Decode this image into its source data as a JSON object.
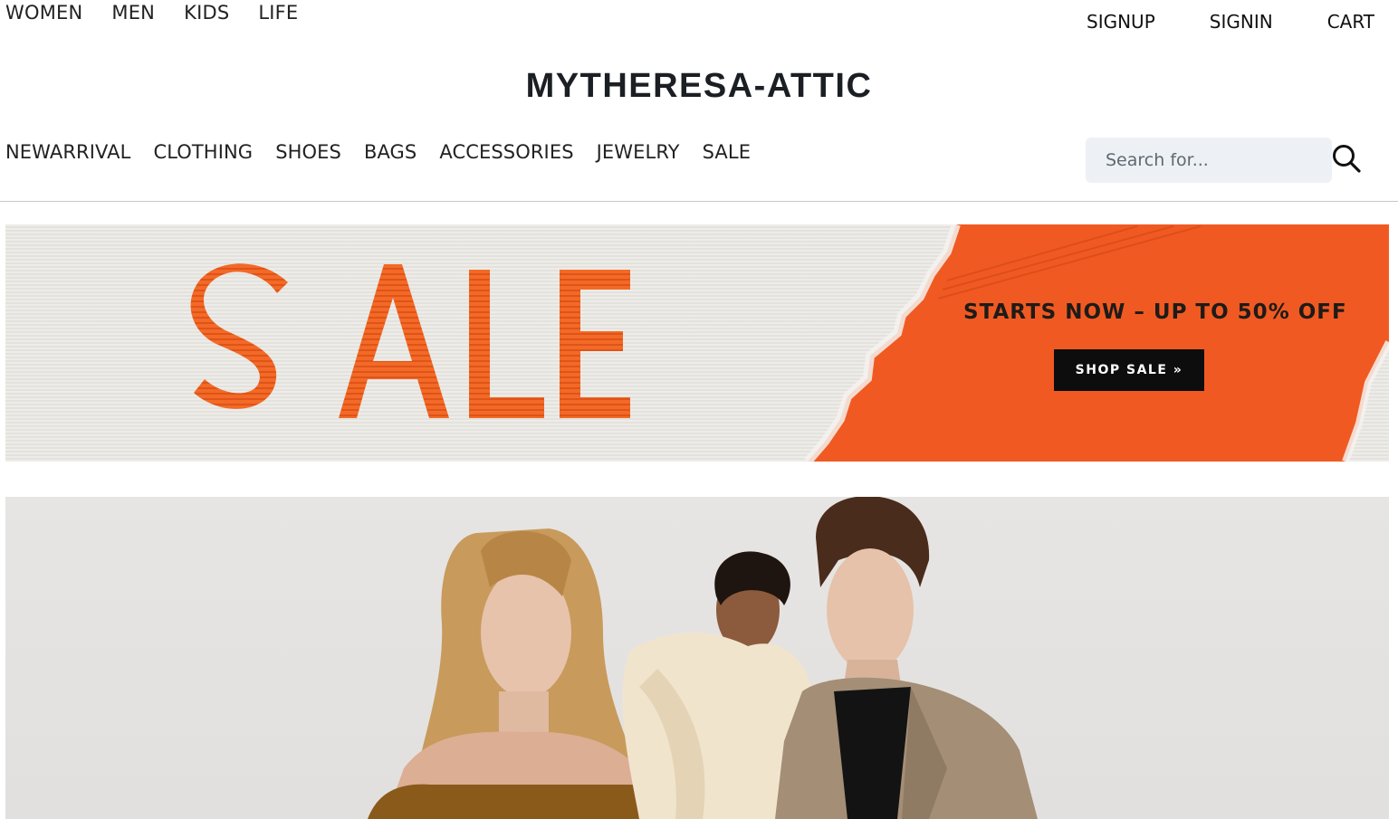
{
  "top_nav": {
    "left": [
      "WOMEN",
      "MEN",
      "KIDS",
      "LIFE"
    ],
    "right": [
      "SIGNUP",
      "SIGNIN",
      "CART"
    ]
  },
  "brand": {
    "name": "MYTHERESA-ATTIC"
  },
  "category_nav": [
    "NEWARRIVAL",
    "CLOTHING",
    "SHOES",
    "BAGS",
    "ACCESSORIES",
    "JEWELRY",
    "SALE"
  ],
  "search": {
    "placeholder": "Search for...",
    "value": "",
    "icon": "search-icon"
  },
  "sale_banner": {
    "big_word": "SALE",
    "headline": "STARTS NOW – UP TO 50% OFF",
    "button_label": "SHOP SALE »",
    "colors": {
      "orange": "#f05a22",
      "paper": "#e8e6e1",
      "button": "#0d0d0d"
    }
  },
  "hero": {
    "image": "fashion-models-photo",
    "colors": {
      "background": "#e4e2e0"
    }
  }
}
